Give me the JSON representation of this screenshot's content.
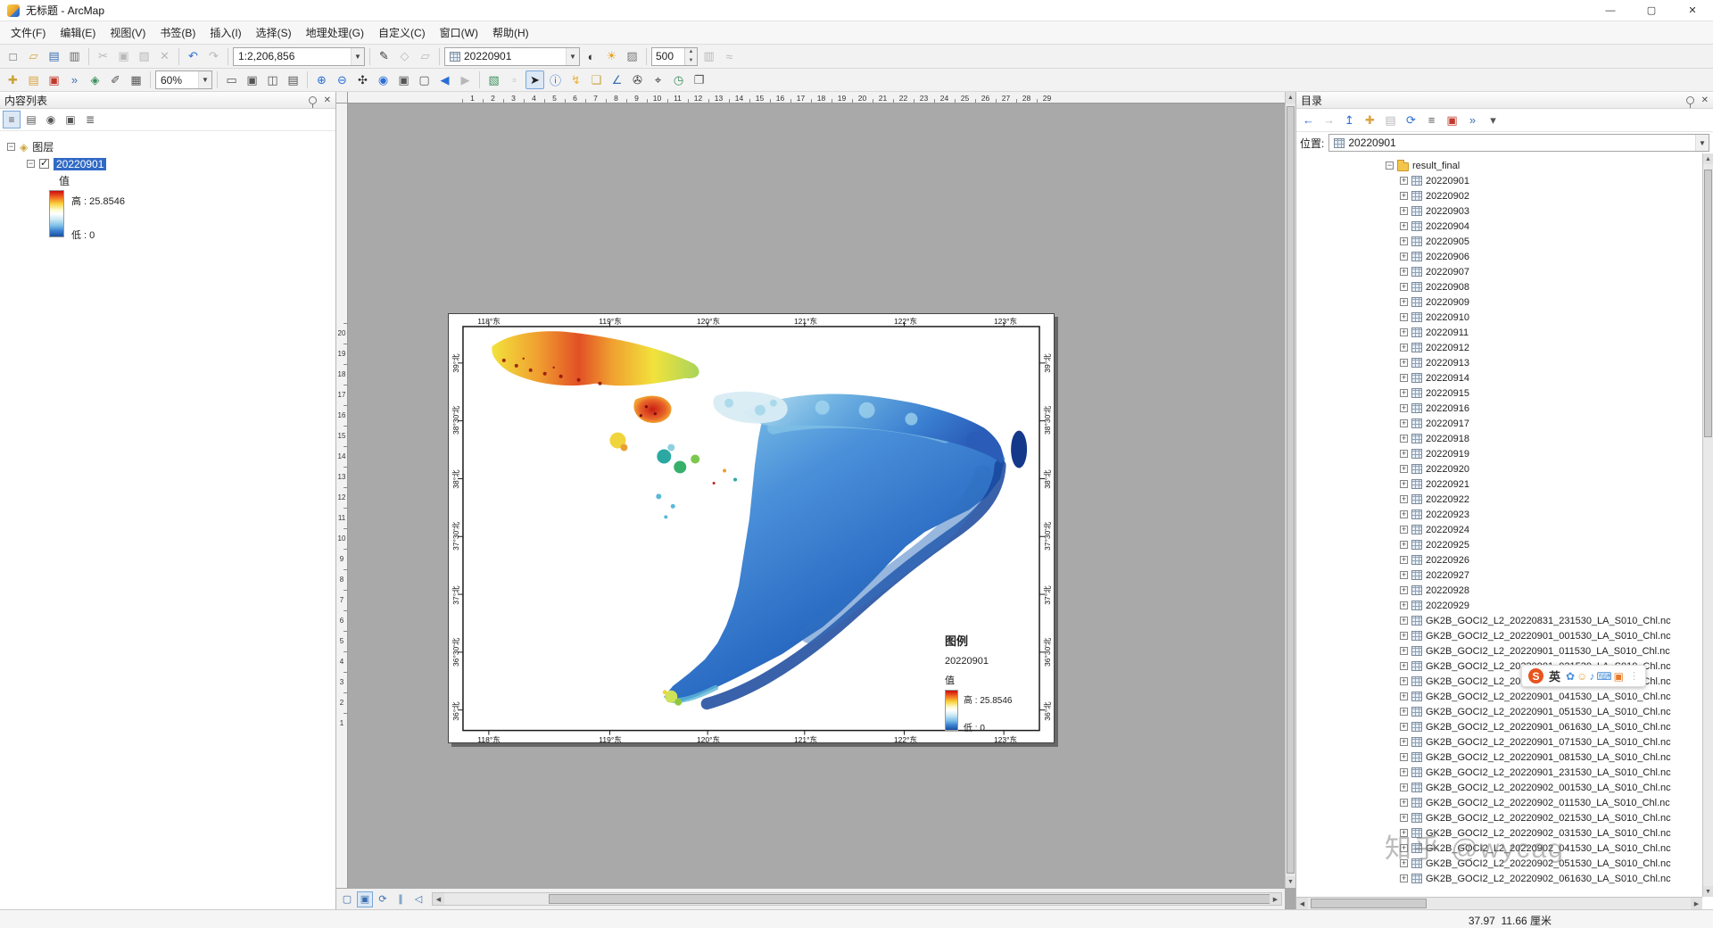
{
  "window": {
    "title": "无标题 - ArcMap",
    "controls": {
      "minimize": "—",
      "maximize": "▢",
      "close": "✕"
    }
  },
  "menu": [
    "文件(F)",
    "编辑(E)",
    "视图(V)",
    "书签(B)",
    "插入(I)",
    "选择(S)",
    "地理处理(G)",
    "自定义(C)",
    "窗口(W)",
    "帮助(H)"
  ],
  "toolbar_standard": {
    "file_icons": [
      {
        "name": "new-document-icon",
        "glyph": "□",
        "color": "#555"
      },
      {
        "name": "open-folder-icon",
        "glyph": "▱",
        "color": "#d9a441"
      },
      {
        "name": "save-icon",
        "glyph": "▤",
        "color": "#3a6fb0"
      },
      {
        "name": "print-icon",
        "glyph": "▥",
        "color": "#666"
      }
    ],
    "edit_icons": [
      {
        "name": "cut-icon",
        "glyph": "✂",
        "cls": "disabled"
      },
      {
        "name": "copy-icon",
        "glyph": "▣",
        "cls": "disabled"
      },
      {
        "name": "paste-icon",
        "glyph": "▨",
        "cls": "disabled"
      },
      {
        "name": "delete-icon",
        "glyph": "✕",
        "cls": "disabled"
      }
    ],
    "undo_redo": [
      {
        "name": "undo-icon",
        "glyph": "↶",
        "color": "#2a6fd6"
      },
      {
        "name": "redo-icon",
        "glyph": "↷",
        "cls": "disabled"
      }
    ],
    "scale_value": "1:2,206,856",
    "editor_icons": [
      {
        "name": "editor-pencil-icon",
        "glyph": "✎",
        "color": "#333"
      },
      {
        "name": "snapping-icon",
        "glyph": "◇",
        "cls": "disabled"
      },
      {
        "name": "annotation-icon",
        "glyph": "▱",
        "cls": "disabled"
      }
    ],
    "layer_value": "20220901",
    "image_icons": [
      {
        "name": "contrast-icon",
        "glyph": "◐",
        "color": "#333"
      },
      {
        "name": "brightness-icon",
        "glyph": "☀",
        "color": "#e8a020"
      },
      {
        "name": "transparency-icon",
        "glyph": "▨",
        "color": "#777"
      }
    ],
    "spinner_value": "500",
    "tail_icons": [
      {
        "name": "swipe-layer-icon",
        "glyph": "▥",
        "cls": "disabled"
      },
      {
        "name": "flicker-icon",
        "glyph": "≈",
        "cls": "disabled"
      }
    ]
  },
  "toolbar_tools": {
    "left_icons": [
      {
        "name": "add-data-icon",
        "glyph": "✚",
        "color": "#caa23a"
      },
      {
        "name": "arccatalog-icon",
        "glyph": "▤",
        "color": "#d9a441"
      },
      {
        "name": "arctoolbox-icon",
        "glyph": "▣",
        "color": "#c0392b"
      },
      {
        "name": "python-icon",
        "glyph": "»",
        "color": "#3a6fb0"
      },
      {
        "name": "model-builder-icon",
        "glyph": "◈",
        "color": "#3a8f5a"
      },
      {
        "name": "editor-toolbar-icon",
        "glyph": "✐",
        "color": "#555"
      },
      {
        "name": "table-icon",
        "glyph": "▦",
        "color": "#555"
      }
    ],
    "zoom_value": "60%",
    "layout_icons": [
      {
        "name": "zoom-whole-page-icon",
        "glyph": "▭",
        "color": "#555"
      },
      {
        "name": "zoom-100-icon",
        "glyph": "▣",
        "color": "#555"
      },
      {
        "name": "focus-dataframe-icon",
        "glyph": "◫",
        "color": "#555"
      },
      {
        "name": "change-layout-icon",
        "glyph": "▤",
        "color": "#555"
      }
    ],
    "nav_icons": [
      {
        "name": "zoom-in-icon",
        "glyph": "⊕",
        "color": "#2a6fd6"
      },
      {
        "name": "zoom-out-icon",
        "glyph": "⊖",
        "color": "#2a6fd6"
      },
      {
        "name": "pan-icon",
        "glyph": "✣",
        "color": "#333"
      },
      {
        "name": "full-extent-icon",
        "glyph": "◉",
        "color": "#2a6fd6"
      },
      {
        "name": "fixed-zoom-in-icon",
        "glyph": "▣",
        "color": "#555"
      },
      {
        "name": "fixed-zoom-out-icon",
        "glyph": "▢",
        "color": "#555"
      },
      {
        "name": "back-extent-icon",
        "glyph": "◀",
        "color": "#2a6fd6"
      },
      {
        "name": "forward-extent-icon",
        "glyph": "▶",
        "cls": "disabled"
      }
    ],
    "select_icons": [
      {
        "name": "select-features-icon",
        "glyph": "▧",
        "color": "#3a8f5a"
      },
      {
        "name": "clear-selection-icon",
        "glyph": "▫",
        "cls": "disabled"
      },
      {
        "name": "select-elements-icon",
        "glyph": "➤",
        "cls": "active",
        "color": "#222"
      },
      {
        "name": "identify-icon",
        "glyph": "ⓘ",
        "color": "#2a6fd6"
      },
      {
        "name": "hyperlink-icon",
        "glyph": "↯",
        "color": "#e8b13d"
      },
      {
        "name": "html-popup-icon",
        "glyph": "❑",
        "color": "#caa23a"
      },
      {
        "name": "measure-icon",
        "glyph": "∠",
        "color": "#3a6fb0"
      },
      {
        "name": "find-icon",
        "glyph": "✇",
        "color": "#333"
      },
      {
        "name": "go-to-xy-icon",
        "glyph": "⌖",
        "color": "#333"
      },
      {
        "name": "time-slider-icon",
        "glyph": "◷",
        "color": "#3a8f5a"
      },
      {
        "name": "viewer-window-icon",
        "glyph": "❐",
        "color": "#555"
      }
    ]
  },
  "toc": {
    "title": "内容列表",
    "tools": [
      {
        "name": "toc-list-by-drawing-order-icon",
        "glyph": "≡",
        "cls": "active"
      },
      {
        "name": "toc-list-by-source-icon",
        "glyph": "▤"
      },
      {
        "name": "toc-list-by-visibility-icon",
        "glyph": "◉"
      },
      {
        "name": "toc-list-by-selection-icon",
        "glyph": "▣"
      },
      {
        "name": "toc-options-icon",
        "glyph": "≣"
      }
    ],
    "root_label": "图层",
    "layer": {
      "name": "20220901",
      "field": "值",
      "high_label": "高 : 25.8546",
      "low_label": "低 : 0"
    }
  },
  "map": {
    "hruler": [
      "1",
      "2",
      "3",
      "4",
      "5",
      "6",
      "7",
      "8",
      "9",
      "10",
      "11",
      "12",
      "13",
      "14",
      "15",
      "16",
      "17",
      "18",
      "19",
      "20",
      "21",
      "22",
      "23",
      "24",
      "25",
      "26",
      "27",
      "28",
      "29"
    ],
    "vruler": [
      "20",
      "19",
      "18",
      "17",
      "16",
      "15",
      "14",
      "13",
      "12",
      "11",
      "10",
      "9",
      "8",
      "7",
      "6",
      "5",
      "4",
      "3",
      "2",
      "1"
    ],
    "lon_labels": [
      "118°东",
      "119°东",
      "120°东",
      "121°东",
      "122°东",
      "123°东"
    ],
    "lat_labels": [
      "39°北",
      "38°30'北",
      "38°北",
      "37°30'北",
      "37°北",
      "36°30'北",
      "36°北"
    ],
    "legend": {
      "title": "图例",
      "layer": "20220901",
      "field": "值",
      "high": "高 : 25.8546",
      "low": "低 : 0"
    },
    "bottom_tools": [
      {
        "name": "data-view-icon",
        "glyph": "▢"
      },
      {
        "name": "layout-view-icon",
        "glyph": "▣",
        "cls": "active"
      },
      {
        "name": "refresh-view-icon",
        "glyph": "⟳"
      },
      {
        "name": "pause-drawing-icon",
        "glyph": "∥"
      },
      {
        "name": "back-page-icon",
        "glyph": "◁"
      }
    ]
  },
  "catalog": {
    "title": "目录",
    "tools": [
      {
        "name": "back-icon",
        "glyph": "←",
        "color": "#2a6fd6"
      },
      {
        "name": "forward-icon",
        "glyph": "→",
        "cls": "disabled"
      },
      {
        "name": "up-one-level-icon",
        "glyph": "↥",
        "color": "#2a6fd6"
      },
      {
        "name": "connect-folder-icon",
        "glyph": "✚",
        "color": "#d9a441"
      },
      {
        "name": "disconnect-folder-icon",
        "glyph": "▤",
        "cls": "disabled"
      },
      {
        "name": "refresh-icon",
        "glyph": "⟳",
        "color": "#2a6fd6"
      },
      {
        "name": "tree-view-icon",
        "glyph": "≡",
        "color": "#555"
      },
      {
        "name": "arctoolbox-window-icon",
        "glyph": "▣",
        "color": "#c0392b"
      },
      {
        "name": "python-window-icon",
        "glyph": "»",
        "color": "#3a6fb0"
      },
      {
        "name": "options-icon",
        "glyph": "▾",
        "color": "#555"
      }
    ],
    "location_label": "位置:",
    "location_value": "20220901",
    "root_folder": "result_final",
    "dates": [
      "20220901",
      "20220902",
      "20220903",
      "20220904",
      "20220905",
      "20220906",
      "20220907",
      "20220908",
      "20220909",
      "20220910",
      "20220911",
      "20220912",
      "20220913",
      "20220914",
      "20220915",
      "20220916",
      "20220917",
      "20220918",
      "20220919",
      "20220920",
      "20220921",
      "20220922",
      "20220923",
      "20220924",
      "20220925",
      "20220926",
      "20220927",
      "20220928",
      "20220929"
    ],
    "files": [
      "GK2B_GOCI2_L2_20220831_231530_LA_S010_Chl.nc",
      "GK2B_GOCI2_L2_20220901_001530_LA_S010_Chl.nc",
      "GK2B_GOCI2_L2_20220901_011530_LA_S010_Chl.nc",
      "GK2B_GOCI2_L2_20220901_021530_LA_S010_Chl.nc",
      "GK2B_GOCI2_L2_20220901_031530_LA_S010_Chl.nc",
      "GK2B_GOCI2_L2_20220901_041530_LA_S010_Chl.nc",
      "GK2B_GOCI2_L2_20220901_051530_LA_S010_Chl.nc",
      "GK2B_GOCI2_L2_20220901_061630_LA_S010_Chl.nc",
      "GK2B_GOCI2_L2_20220901_071530_LA_S010_Chl.nc",
      "GK2B_GOCI2_L2_20220901_081530_LA_S010_Chl.nc",
      "GK2B_GOCI2_L2_20220901_231530_LA_S010_Chl.nc",
      "GK2B_GOCI2_L2_20220902_001530_LA_S010_Chl.nc",
      "GK2B_GOCI2_L2_20220902_011530_LA_S010_Chl.nc",
      "GK2B_GOCI2_L2_20220902_021530_LA_S010_Chl.nc",
      "GK2B_GOCI2_L2_20220902_031530_LA_S010_Chl.nc",
      "GK2B_GOCI2_L2_20220902_041530_LA_S010_Chl.nc",
      "GK2B_GOCI2_L2_20220902_051530_LA_S010_Chl.nc",
      "GK2B_GOCI2_L2_20220902_061630_LA_S010_Chl.nc"
    ]
  },
  "statusbar": {
    "coords": "37.97  11.66 厘米"
  },
  "ime": {
    "logo": "S",
    "lang": "英",
    "icons": [
      {
        "name": "sogou-skin-icon",
        "glyph": "✿",
        "color": "#4a90d9"
      },
      {
        "name": "sogou-emoji-icon",
        "glyph": "☺",
        "color": "#e8a33d"
      },
      {
        "name": "sogou-mic-icon",
        "glyph": "♪",
        "color": "#4a90d9"
      },
      {
        "name": "sogou-keyboard-icon",
        "glyph": "⌨",
        "color": "#4a90d9"
      },
      {
        "name": "sogou-toolbox-icon",
        "glyph": "▣",
        "color": "#e87a2a"
      }
    ]
  },
  "watermark": {
    "text": "知乎 @wycag"
  }
}
